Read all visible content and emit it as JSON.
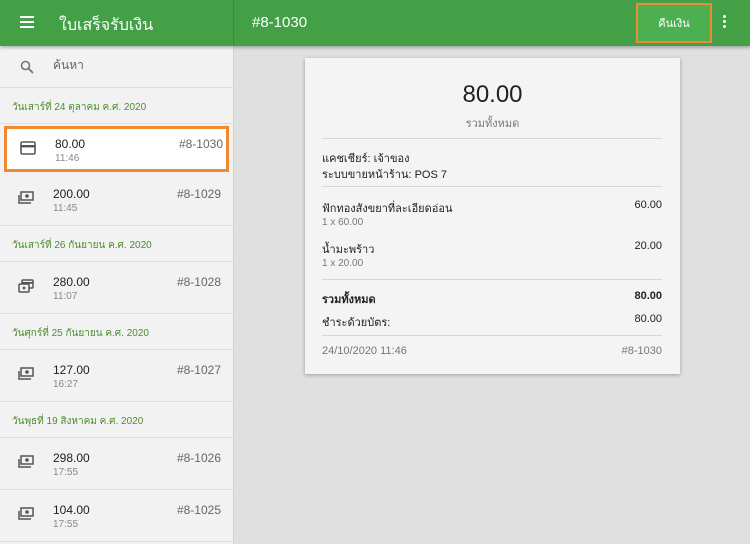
{
  "header": {
    "app_title": "ใบเสร็จรับเงิน",
    "receipt_title": "#8-1030",
    "refund_label": "คืนเงิน"
  },
  "search": {
    "placeholder": "ค้นหา"
  },
  "groups": [
    {
      "date": "วันเสาร์ที่ 24 ตุลาคม ค.ศ. 2020"
    },
    {
      "date": "วันเสาร์ที่ 26 กันยายน ค.ศ. 2020"
    },
    {
      "date": "วันศุกร์ที่ 25 กันยายน ค.ศ. 2020"
    },
    {
      "date": "วันพุธที่ 19 สิงหาคม ค.ศ. 2020"
    }
  ],
  "receipts": [
    {
      "amount": "80.00",
      "time": "11:46",
      "number": "#8-1030",
      "icon": "card-icon"
    },
    {
      "amount": "200.00",
      "time": "11:45",
      "number": "#8-1029",
      "icon": "cash-icon"
    },
    {
      "amount": "280.00",
      "time": "11:07",
      "number": "#8-1028",
      "icon": "multiple-payments-icon"
    },
    {
      "amount": "127.00",
      "time": "16:27",
      "number": "#8-1027",
      "icon": "cash-icon"
    },
    {
      "amount": "298.00",
      "time": "17:55",
      "number": "#8-1026",
      "icon": "cash-icon"
    },
    {
      "amount": "104.00",
      "time": "17:55",
      "number": "#8-1025",
      "icon": "cash-icon"
    }
  ],
  "detail": {
    "total": "80.00",
    "total_caption": "รวมทั้งหมด",
    "cashier": "แคชเชียร์: เจ้าของ",
    "pos": "ระบบขายหน้าร้าน: POS 7",
    "items": [
      {
        "name": "ฟักทองสังขยาที่ละเอียดอ่อน",
        "qty": "1 x 60.00",
        "price": "60.00"
      },
      {
        "name": "น้ำมะพร้าว",
        "qty": "1 x 20.00",
        "price": "20.00"
      }
    ],
    "total_label": "รวมทั้งหมด",
    "total_value": "80.00",
    "paid_label": "ชำระด้วยบัตร:",
    "paid_value": "80.00",
    "datetime": "24/10/2020 11:46",
    "number": "#8-1030"
  },
  "colors": {
    "primary": "#43a047",
    "accent_outline": "#f08a32",
    "date_header": "#4c8c2f"
  }
}
